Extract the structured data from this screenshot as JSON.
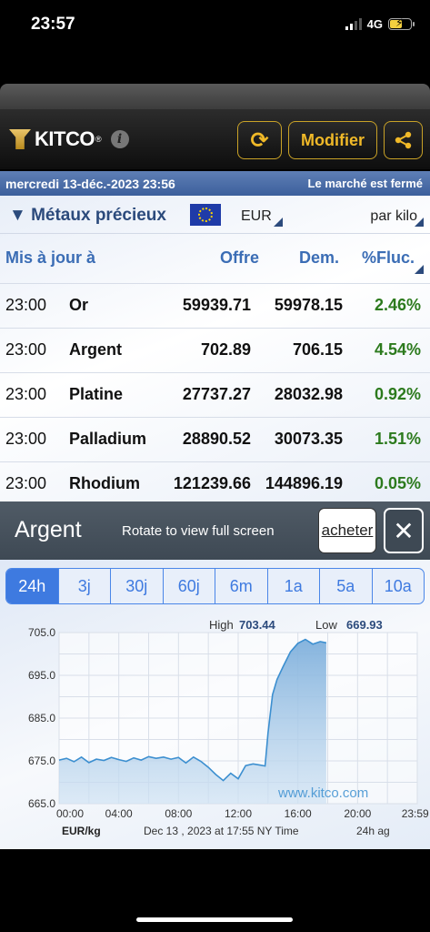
{
  "status_bar": {
    "time": "23:57",
    "network": "4G"
  },
  "header": {
    "logo_text": "KITCO",
    "logo_reg": "®",
    "info_icon": "i",
    "refresh_icon": "⟳",
    "modify_label": "Modifier",
    "share_icon": "share-icon"
  },
  "date_bar": {
    "date": "mercredi 13-déc.-2023 23:56",
    "market_status": "Le marché est fermé"
  },
  "metals_bar": {
    "title": "▼ Métaux précieux",
    "currency": "EUR",
    "unit": "par kilo"
  },
  "table": {
    "headers": {
      "updated": "Mis à jour à",
      "bid": "Offre",
      "ask": "Dem.",
      "change": "%Fluc."
    },
    "rows": [
      {
        "time": "23:00",
        "name": "Or",
        "bid": "59939.71",
        "ask": "59978.15",
        "change": "2.46%"
      },
      {
        "time": "23:00",
        "name": "Argent",
        "bid": "702.89",
        "ask": "706.15",
        "change": "4.54%"
      },
      {
        "time": "23:00",
        "name": "Platine",
        "bid": "27737.27",
        "ask": "28032.98",
        "change": "0.92%"
      },
      {
        "time": "23:00",
        "name": "Palladium",
        "bid": "28890.52",
        "ask": "30073.35",
        "change": "1.51%"
      },
      {
        "time": "23:00",
        "name": "Rhodium",
        "bid": "121239.66",
        "ask": "144896.19",
        "change": "0.05%"
      }
    ]
  },
  "chart_panel": {
    "title": "Argent",
    "hint": "Rotate to view full screen",
    "buy_label": "acheter",
    "close_icon": "✕",
    "tabs": [
      "24h",
      "3j",
      "30j",
      "60j",
      "6m",
      "1a",
      "5a",
      "10a"
    ],
    "active_tab": "24h"
  },
  "chart_data": {
    "type": "area",
    "high_label": "High",
    "high_value": "703.44",
    "low_label": "Low",
    "low_value": "669.93",
    "watermark": "www.kitco.com",
    "y_ticks": [
      "705.0",
      "695.0",
      "685.0",
      "675.0",
      "665.0"
    ],
    "x_ticks": [
      "00:00",
      "04:00",
      "08:00",
      "12:00",
      "16:00",
      "20:00",
      "23:59"
    ],
    "ylim": [
      665,
      705
    ],
    "xlim": [
      0,
      24
    ],
    "unit_label": "EUR/kg",
    "footer_label": "Dec 13 , 2023 at 17:55 NY Time",
    "range_label": "24h ag",
    "series": [
      {
        "x": [
          0,
          0.5,
          1,
          1.5,
          2,
          2.5,
          3,
          3.5,
          4,
          4.5,
          5,
          5.5,
          6,
          6.5,
          7,
          7.5,
          8,
          8.5,
          9,
          9.5,
          10,
          10.5,
          11,
          11.5,
          12,
          12.5,
          13,
          13.5,
          13.8,
          14,
          14.3,
          14.6,
          15,
          15.5,
          16,
          16.5,
          17,
          17.5,
          17.9
        ],
        "y": [
          675.2,
          675.6,
          674.8,
          675.9,
          674.6,
          675.4,
          675.1,
          675.8,
          675.3,
          674.9,
          675.7,
          675.2,
          676.0,
          675.6,
          675.9,
          675.4,
          675.8,
          674.5,
          675.9,
          674.9,
          673.5,
          671.8,
          670.4,
          672.1,
          670.8,
          673.9,
          674.3,
          674.0,
          673.8,
          681.5,
          690.5,
          694.0,
          697.0,
          700.5,
          702.5,
          703.4,
          702.3,
          702.9,
          702.6
        ]
      }
    ]
  }
}
